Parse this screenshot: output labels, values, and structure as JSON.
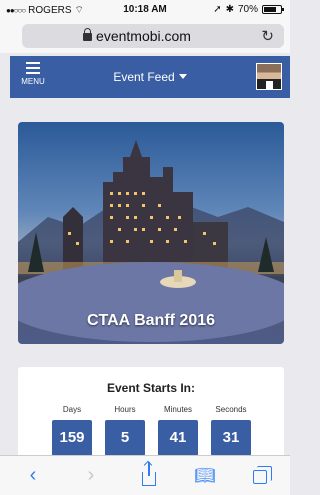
{
  "status_bar": {
    "carrier": "ROGERS",
    "time": "10:18 AM",
    "battery": "70%",
    "battery_level": 0.7
  },
  "browser": {
    "url": "eventmobi.com"
  },
  "nav": {
    "menu_label": "MENU",
    "title": "Event Feed"
  },
  "hero": {
    "caption": "CTAA Banff 2016"
  },
  "countdown": {
    "heading": "Event Starts In:",
    "units": [
      {
        "label": "Days",
        "value": "159"
      },
      {
        "label": "Hours",
        "value": "5"
      },
      {
        "label": "Minutes",
        "value": "41"
      },
      {
        "label": "Seconds",
        "value": "31"
      }
    ]
  },
  "colors": {
    "brand": "#3a5ea3",
    "ios_blue": "#2d7cf6",
    "page_bg": "#e9e9ee"
  }
}
